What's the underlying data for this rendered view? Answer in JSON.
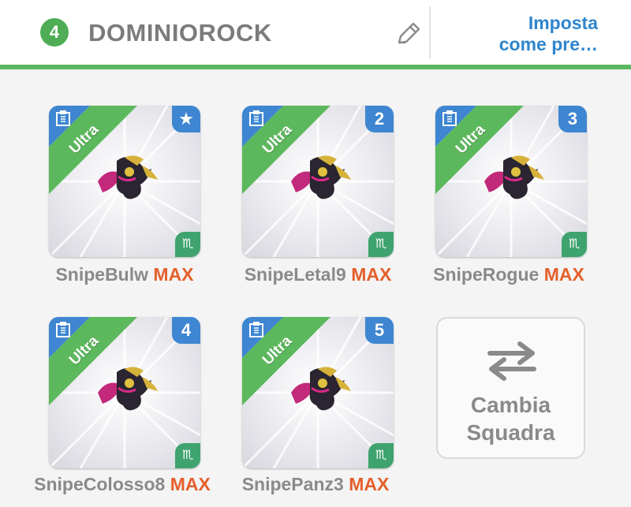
{
  "header": {
    "team_number": "4",
    "team_name": "DOMINIOROCK",
    "preset_line1": "Imposta",
    "preset_line2": "come pre…"
  },
  "cards": [
    {
      "ribbon": "Ultra",
      "badge": "★",
      "badge_icon": "star-icon",
      "sign": "♏",
      "name": "SnipeBulw",
      "level": "MAX"
    },
    {
      "ribbon": "Ultra",
      "badge": "2",
      "sign": "♏",
      "name": "SnipeLetal9",
      "level": "MAX"
    },
    {
      "ribbon": "Ultra",
      "badge": "3",
      "sign": "♏",
      "name": "SnipeRogue",
      "level": "MAX"
    },
    {
      "ribbon": "Ultra",
      "badge": "4",
      "sign": "♏",
      "name": "SnipeColosso8",
      "level": "MAX"
    },
    {
      "ribbon": "Ultra",
      "badge": "5",
      "sign": "♏",
      "name": "SnipePanz3",
      "level": "MAX"
    }
  ],
  "swap": {
    "line1": "Cambia",
    "line2": "Squadra"
  },
  "colors": {
    "green": "#5cb860",
    "blue": "#3e86d2",
    "max": "#e5602b",
    "link": "#2f85cc"
  }
}
